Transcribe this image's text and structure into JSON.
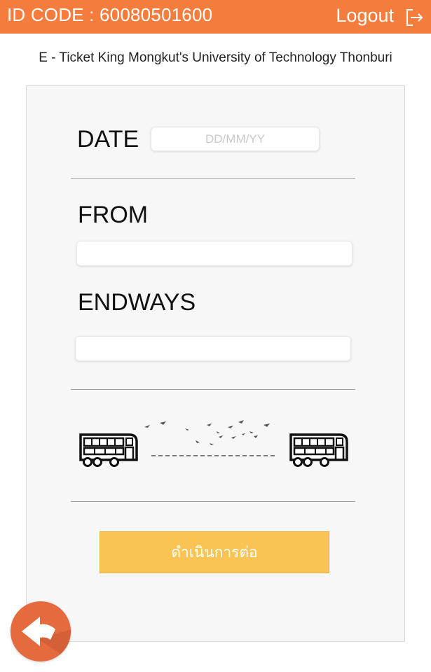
{
  "header": {
    "id_code": "ID CODE : 60080501600",
    "logout_label": "Logout",
    "logout_icon": "logout-icon",
    "bg_color": "#f47c3c"
  },
  "subtitle": "E - Ticket King Mongkut's University of Technology Thonburi",
  "form": {
    "date_label": "DATE",
    "date_placeholder": "DD/MM/YY",
    "date_value": "",
    "from_label": "FROM",
    "from_value": "",
    "endways_label": "ENDWAYS",
    "endways_value": ""
  },
  "illustration": {
    "left_icon": "bus-icon",
    "right_icon": "bus-icon",
    "middle": "flying-birds-icon"
  },
  "continue_button": {
    "label": "ดำเนินการต่อ",
    "color": "#f9c453"
  },
  "back_button": {
    "icon": "back-arrow-icon",
    "color": "#e56a3e"
  }
}
